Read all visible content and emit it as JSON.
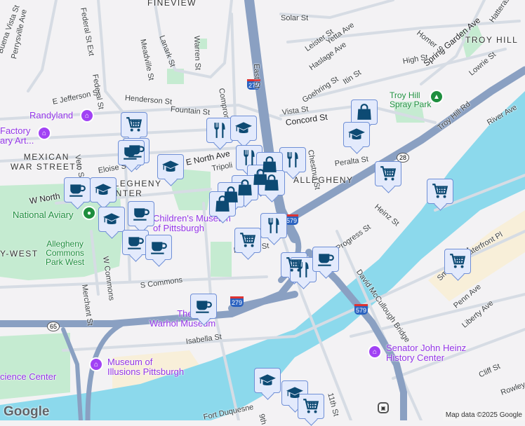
{
  "neighborhoods": {
    "fineview": "FINEVIEW",
    "troy_hill": "TROY HILL",
    "mexican_war_streets": "MEXICAN\nWAR STREETS",
    "allegheny_center": "ALLEGHENY\nCENTER",
    "allegheny": "ALLEGHENY",
    "west": "Y-WEST"
  },
  "streets": [
    "Perrysville Ave",
    "Federal St",
    "Meadville St",
    "Lanark St",
    "Warren St",
    "Compromise St",
    "East St",
    "Solar St",
    "Leister St",
    "Yetta Ave",
    "Haslage Ave",
    "Goehring St",
    "Itin St",
    "High St",
    "Spring Garden Ave",
    "Homer St",
    "Hatteras",
    "Lowrie St",
    "Troy Hill Rd",
    "River Ave",
    "Vista St",
    "Concord St",
    "Chestnut St",
    "Peralta St",
    "Heinz St",
    "E Jefferson St",
    "Henderson St",
    "Fountain St",
    "Veto St",
    "Eloise St",
    "E North Ave",
    "Tripoli",
    "W North",
    "Merchant St",
    "W Commons",
    "S Commons",
    "Isabella St",
    "David McCullough Bridge",
    "Smallman St",
    "Penn Ave",
    "Liberty Ave",
    "Cliff St",
    "Rowley",
    "11th St",
    "9th",
    "Fort Duquesne",
    "Progress St",
    "Waterfront Pl",
    "Prebley St",
    "Federal St Ext",
    "Buena Vista St"
  ],
  "pois": {
    "randyland": "Randyland",
    "factory": "Factory\nary Art...",
    "aviary": "National Aviary",
    "childrens": "Children's Museum\nof Pittsburgh",
    "warhol": "The Andy\nWarhol Museum",
    "illusions": "Museum of\nIllusions Pittsburgh",
    "science": "cience Center",
    "heinz": "Senator John Heinz\nHistory Center"
  },
  "parks": {
    "spray": "Troy Hill\nSpray Park",
    "commons": "Allegheny\nCommons\nPark West"
  },
  "routes": {
    "i279": "279",
    "i579": "579",
    "r28": "28",
    "r65": "65"
  },
  "footer": {
    "logo": "Google",
    "attribution": "Map data ©2025 Google"
  },
  "colors": {
    "water": "#8cd9ec",
    "highway": "#8aa0c2",
    "park": "#c5ebd1",
    "marker": "#e3eafc",
    "icon": "#0d4a73"
  }
}
